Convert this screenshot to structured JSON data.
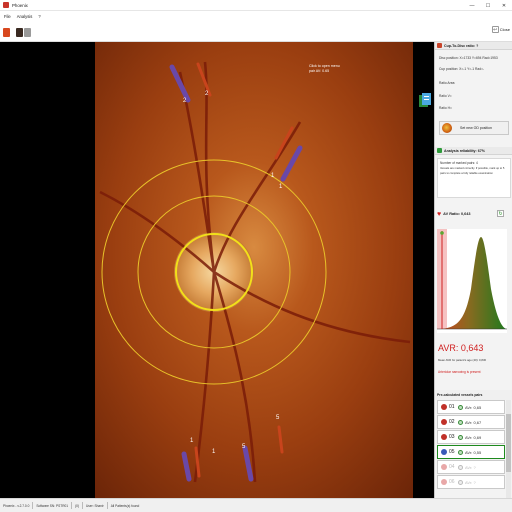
{
  "window": {
    "title": "Phoenix",
    "minimize": "—",
    "maximize": "☐",
    "close": "✕"
  },
  "menu": {
    "items": [
      "File",
      "Analysis",
      "?"
    ]
  },
  "toolbar": {
    "close_label": "Close"
  },
  "viewer": {
    "hint_line1": "Click to open menu",
    "hint_line2": "pair AV: 0.65",
    "vessel_labels": [
      "2",
      "2",
      "1",
      "1",
      "1",
      "1",
      "5",
      "5"
    ],
    "circle_color": "#e8c22a",
    "od_circle_color": "#f2e01a"
  },
  "panel": {
    "cup_disc": {
      "title": "Cup-To-Disc ratio: ?",
      "disc_position": "Disc position: X=1733 Y=694 Rad=1953",
      "cup_position": "Cup position: X=-1 Y=-1 Rad=-",
      "ratio_area": "Ratio Area:",
      "ratio_v": "Ratio V=",
      "ratio_h": "Ratio H=",
      "button_label": "Set new OD position"
    },
    "reliability": {
      "title": "Analysis reliability: 67%",
      "line1": "Number of marked pairs: 4",
      "line2": "Vessels are marked correctly. If possible, mark up to 5",
      "line3": "pairs to complete a fully reliable examination"
    },
    "avr": {
      "title": "AV Ratio: 0,643",
      "big": "AVR: 0,643",
      "norm": "Mean AVR for patient's age (40): 0,830",
      "warning": "Arteriolar narrowing is present",
      "value": 0.643
    },
    "pairs": {
      "title": "Pre-calculated vessels pairs",
      "items": [
        {
          "num": "01",
          "val": "AVr: 0,65",
          "ball": "#c03028",
          "enabled": true
        },
        {
          "num": "02",
          "val": "AVr: 0,67",
          "ball": "#c03028",
          "enabled": true
        },
        {
          "num": "03",
          "val": "AVr: 0,69",
          "ball": "#c03028",
          "enabled": true
        },
        {
          "num": "05",
          "val": "AVr: 0,55",
          "ball": "#3a5ab8",
          "enabled": true
        },
        {
          "num": "04",
          "val": "AVr: ?",
          "ball": "#e8a8a8",
          "enabled": false
        },
        {
          "num": "06",
          "val": "AVr: ?",
          "ball": "#e8a8a8",
          "enabled": false
        }
      ]
    }
  },
  "statusbar": {
    "version": "Phoenix - v.2.7.0.0",
    "software": "Software SN: PSTR01",
    "count": "(0)",
    "user": "User: Shanir",
    "patients": "All Patients(s) found"
  }
}
